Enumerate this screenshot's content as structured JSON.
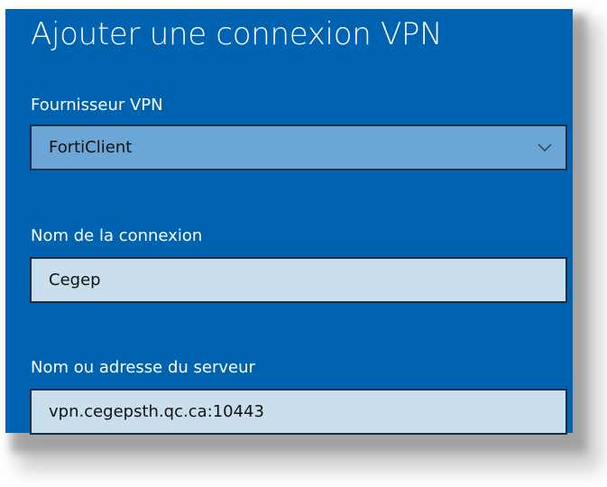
{
  "dialog": {
    "title": "Ajouter une connexion VPN",
    "provider": {
      "label": "Fournisseur VPN",
      "value": "FortiClient"
    },
    "connection_name": {
      "label": "Nom de la connexion",
      "value": "Cegep"
    },
    "server": {
      "label": "Nom ou adresse du serveur",
      "value": "vpn.cegepsth.qc.ca:10443"
    }
  },
  "icons": {
    "dropdown": "chevron-down-icon"
  },
  "colors": {
    "dialog_background": "#0063b1",
    "select_background": "#6ba6d6",
    "input_background": "#c9dfee",
    "border": "#1a2c44",
    "label_text": "#ffffff"
  }
}
